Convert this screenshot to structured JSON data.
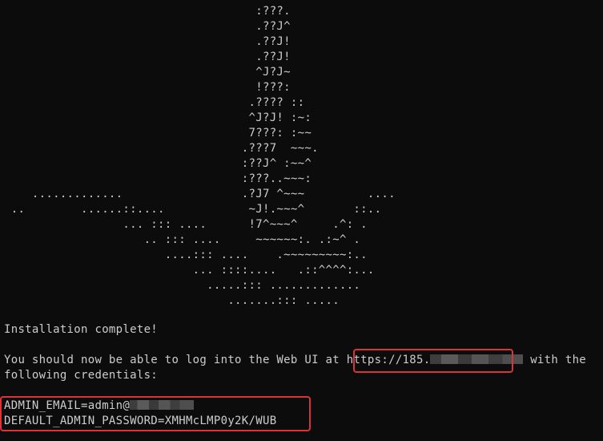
{
  "ascii_art": [
    "                                    :???.",
    "                                    .??J^",
    "                                    .??J!",
    "                                    .??J!",
    "                                    ^J?J~",
    "                                    !???:",
    "                                   .???? ::",
    "                                   ^J?J! :~:",
    "                                   7???: :~~",
    "                                  .???7  ~~~.",
    "                                  :??J^ :~~^",
    "                                  :???..~~~:",
    "    .............                 .?J7 ^~~~         ....",
    " ..        ......::....            ~J!.~~~^       ::..",
    "                 ... ::: ....      !7^~~~^     .^: .",
    "                    .. ::: ....     ~~~~~~:. .:~^ .",
    "                       ....::: ....    .~~~~~~~~~:..",
    "                           ... ::::....   .::^^^^:...",
    "                             .....::: .............",
    "                                .......::: ....."
  ],
  "messages": {
    "install_complete": "Installation complete!",
    "login_prefix": "You should now be able to log into the Web UI at ",
    "url_visible": "https://185.",
    "login_suffix": " with the",
    "credentials_line": "following credentials:",
    "admin_email_prefix": "ADMIN_EMAIL=admin@",
    "admin_password": "DEFAULT_ADMIN_PASSWORD=XMHMcLMP0y2K/WUB"
  },
  "colors": {
    "background": "#0c0c0c",
    "text": "#cccccc",
    "highlight": "#d9343a",
    "redaction": "#4a4a4a"
  }
}
